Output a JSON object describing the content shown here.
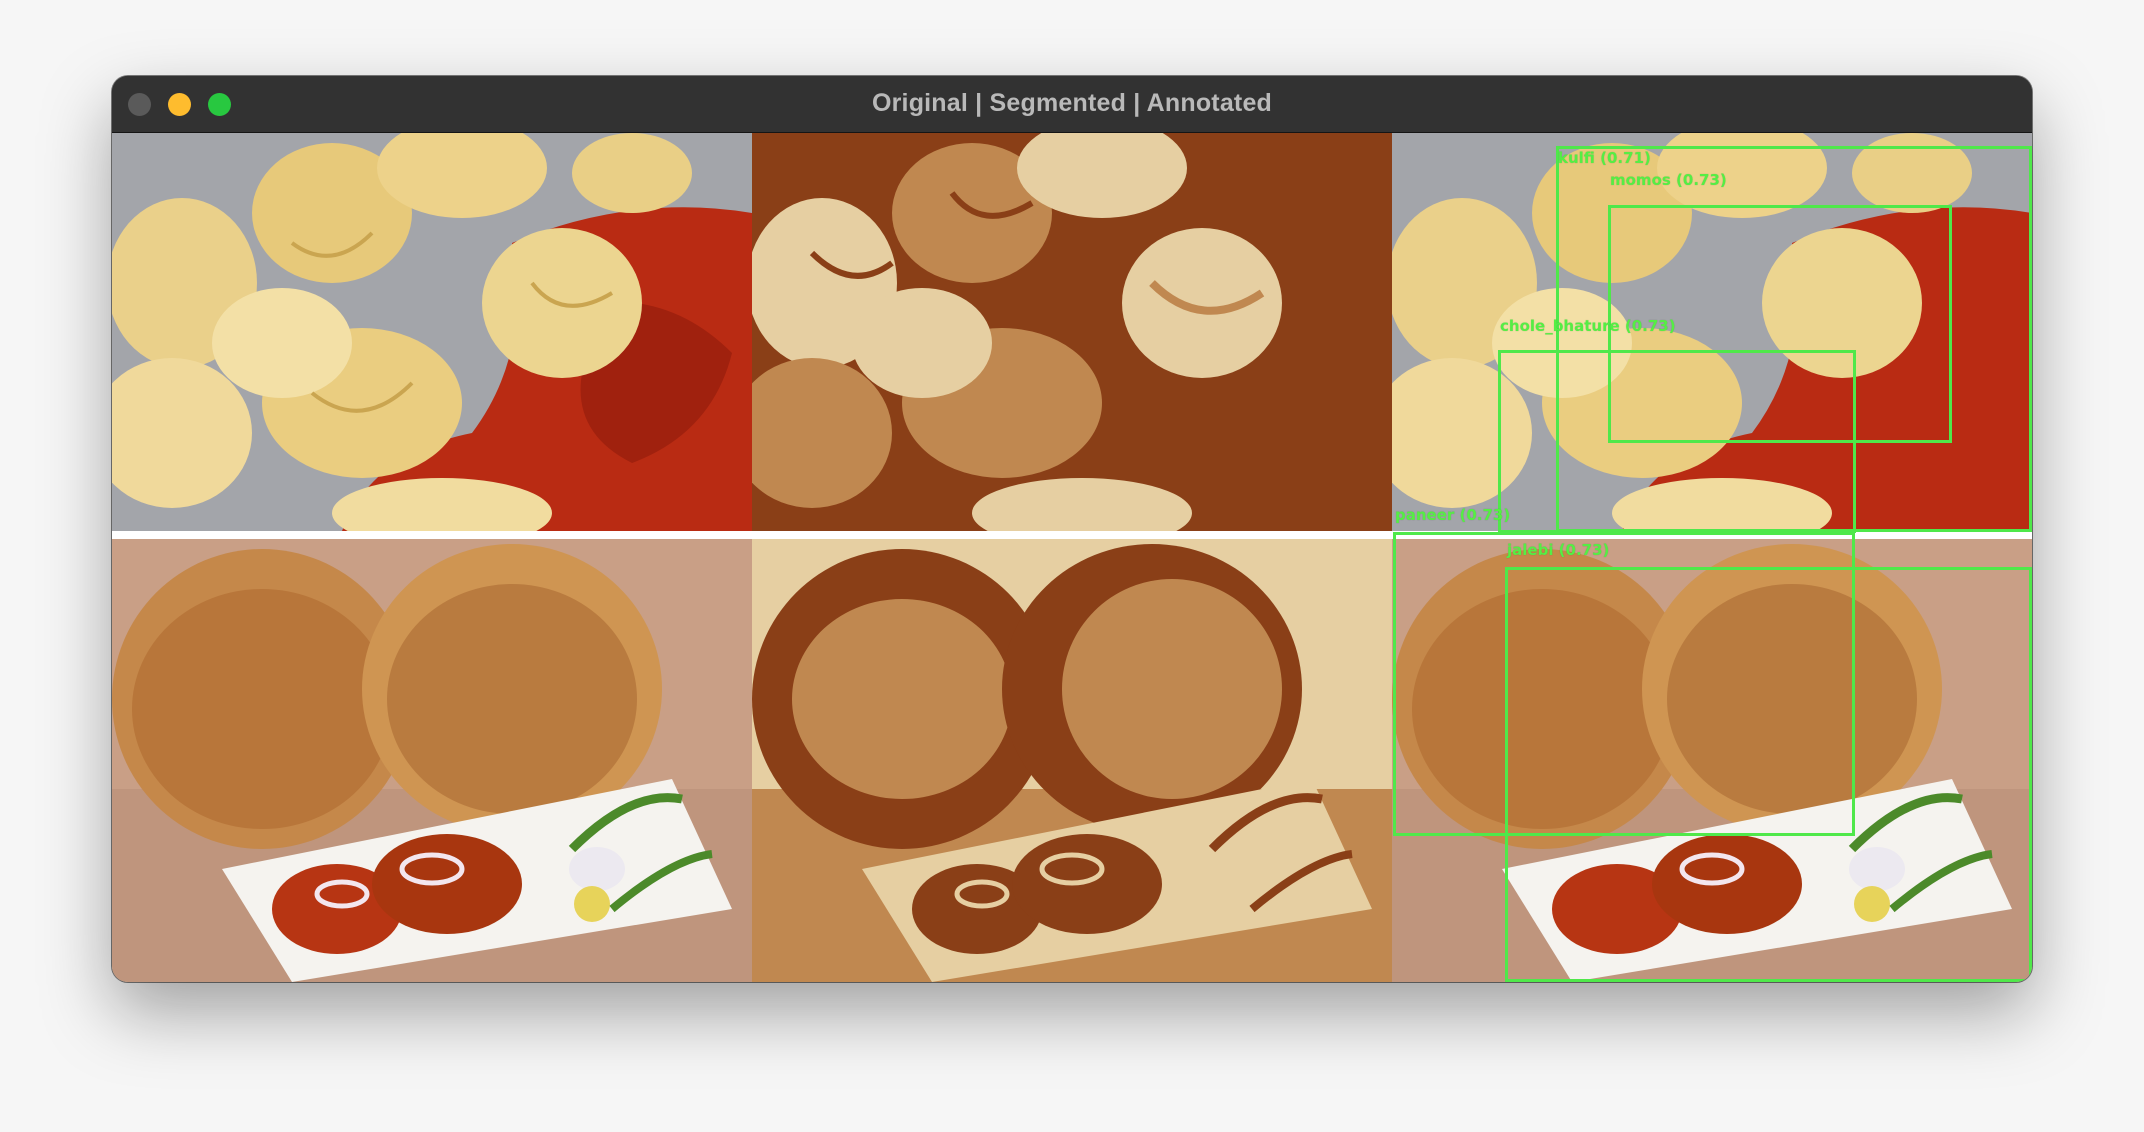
{
  "window": {
    "title": "Original | Segmented | Annotated"
  },
  "panels": {
    "original_label": "Original",
    "segmented_label": "Segmented",
    "annotated_label": "Annotated"
  },
  "detections": [
    {
      "label": "kulfi (0.71)"
    },
    {
      "label": "momos (0.73)"
    },
    {
      "label": "chole_bhature (0.73)"
    },
    {
      "label": "paneer (0.73)"
    },
    {
      "label": "jalebi (0.73)"
    }
  ],
  "colors": {
    "box": "#4fe84a",
    "label": "#55ee44",
    "segment_dark": "#8a3f17",
    "segment_mid": "#c08850",
    "segment_light": "#e6cfa2"
  }
}
